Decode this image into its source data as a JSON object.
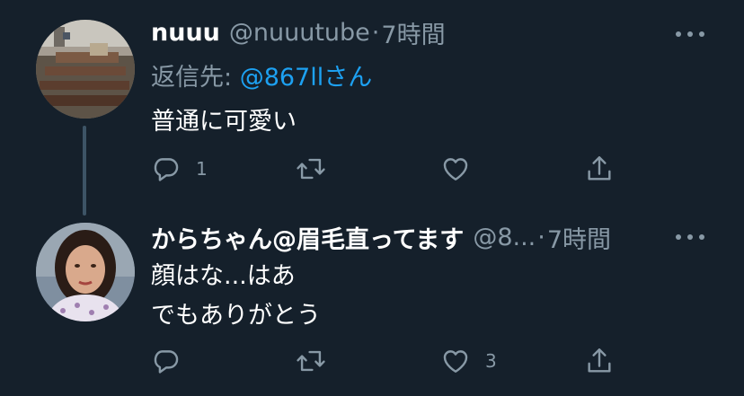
{
  "tweets": [
    {
      "display_name": "nuuu",
      "handle": "@nuuutube",
      "separator": "·",
      "time": "7時間",
      "reply_to_label": "返信先:",
      "reply_to_handle": "@867llさん",
      "text_lines": [
        "普通に可愛い"
      ],
      "reply_count": "1",
      "retweet_count": "",
      "like_count": "",
      "avatar_icon": "classroom-photo-avatar"
    },
    {
      "display_name": "からちゃん@眉毛直ってます",
      "handle": "@8...",
      "separator": "·",
      "time": "7時間",
      "text_lines": [
        "顔はな...はあ",
        "でもありがとう"
      ],
      "reply_count": "",
      "retweet_count": "",
      "like_count": "3",
      "avatar_icon": "person-photo-avatar"
    }
  ],
  "icons": {
    "reply": "reply-icon",
    "retweet": "retweet-icon",
    "like": "heart-icon",
    "share": "share-icon",
    "more": "more-icon"
  },
  "colors": {
    "background": "#15202b",
    "primary_text": "#ffffff",
    "secondary_text": "#8899a6",
    "accent": "#1da1f2",
    "thread_line": "#3d5466"
  }
}
